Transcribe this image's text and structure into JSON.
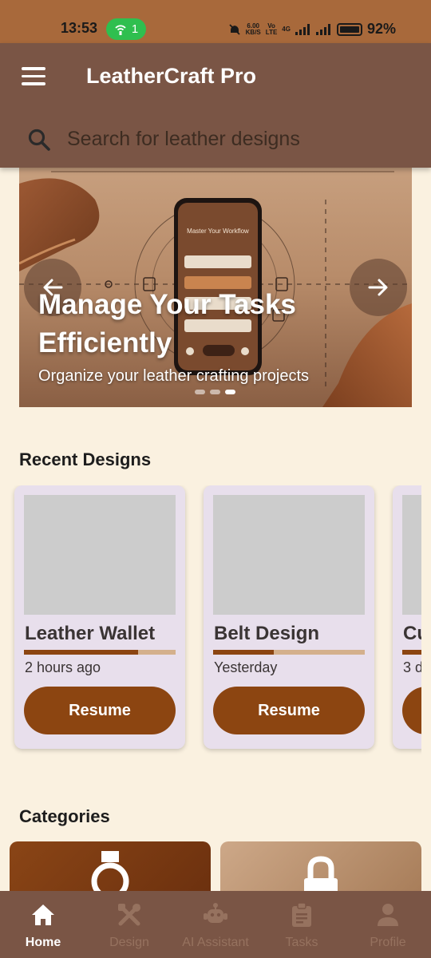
{
  "status_bar": {
    "time": "13:53",
    "hotspot_count": "1",
    "net_speed_value": "6.00",
    "net_speed_unit": "KB/S",
    "volte": "Vo",
    "lte": "LTE",
    "network": "4G",
    "battery": "92%"
  },
  "app_bar": {
    "title": "LeatherCraft Pro",
    "search_placeholder": "Search for leather designs"
  },
  "hero": {
    "title": "Manage Your Tasks Efficiently",
    "subtitle": "Organize your leather crafting projects",
    "phone_heading": "Master Your Workflow",
    "slides": 3,
    "active_slide": 3
  },
  "recent_designs": {
    "title": "Recent Designs",
    "button_label": "Resume",
    "items": [
      {
        "name": "Leather Wallet",
        "time": "2 hours ago",
        "progress": 0.75
      },
      {
        "name": "Belt Design",
        "time": "Yesterday",
        "progress": 0.4
      },
      {
        "name": "Cu",
        "time": "3 d",
        "progress": 0.6
      }
    ]
  },
  "categories": {
    "title": "Categories",
    "items": [
      {
        "icon": "watch-icon"
      },
      {
        "icon": "lock-icon"
      }
    ]
  },
  "bottom_nav": {
    "active": "Home",
    "items": [
      {
        "label": "Home",
        "icon": "home-icon"
      },
      {
        "label": "Design",
        "icon": "design-tools-icon"
      },
      {
        "label": "AI Assistant",
        "icon": "robot-icon"
      },
      {
        "label": "Tasks",
        "icon": "clipboard-icon"
      },
      {
        "label": "Profile",
        "icon": "person-icon"
      }
    ]
  },
  "colors": {
    "status_bar": "#a8693b",
    "app_bar": "#7a5545",
    "background": "#faf1e0",
    "card": "#e8dfec",
    "button": "#8c4511",
    "progress_track": "#d4b08c"
  }
}
